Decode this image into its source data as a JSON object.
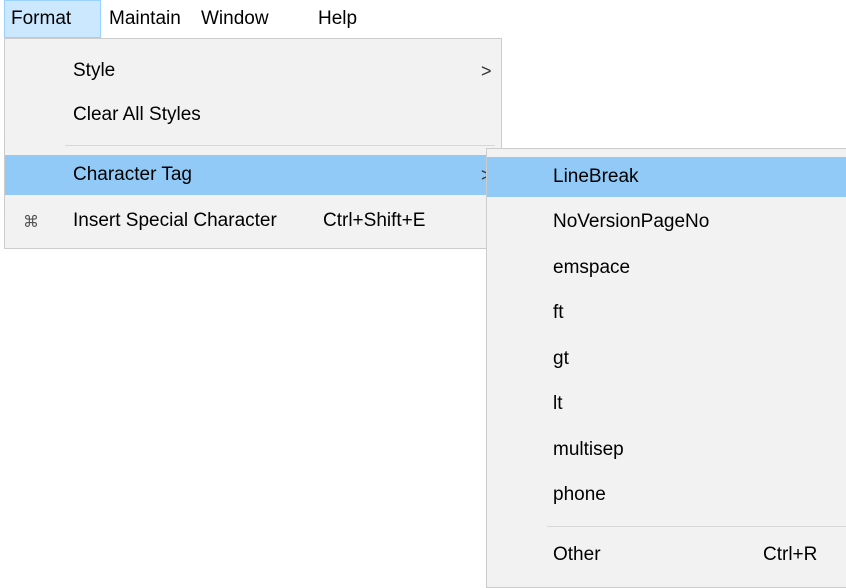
{
  "menubar": {
    "items": [
      {
        "label": "Format"
      },
      {
        "label": "Maintain"
      },
      {
        "label": "Window"
      },
      {
        "label": "Help"
      }
    ]
  },
  "format_menu": {
    "items": [
      {
        "label": "Style",
        "has_submenu": true
      },
      {
        "label": "Clear All Styles"
      },
      {
        "label": "Character Tag",
        "has_submenu": true,
        "highlighted": true
      },
      {
        "label": "Insert Special Character",
        "shortcut": "Ctrl+Shift+E",
        "icon": "special-character-icon"
      }
    ],
    "submenu_arrow": ">"
  },
  "character_tag_submenu": {
    "items": [
      {
        "label": "LineBreak",
        "highlighted": true
      },
      {
        "label": "NoVersionPageNo"
      },
      {
        "label": "emspace"
      },
      {
        "label": "ft"
      },
      {
        "label": "gt"
      },
      {
        "label": "lt"
      },
      {
        "label": "multisep"
      },
      {
        "label": "phone"
      },
      {
        "label": "Other",
        "shortcut": "Ctrl+R"
      }
    ]
  },
  "colors": {
    "menubar_active_bg": "#cce8ff",
    "menu_bg": "#f2f2f2",
    "highlight_bg": "#91c9f7"
  }
}
